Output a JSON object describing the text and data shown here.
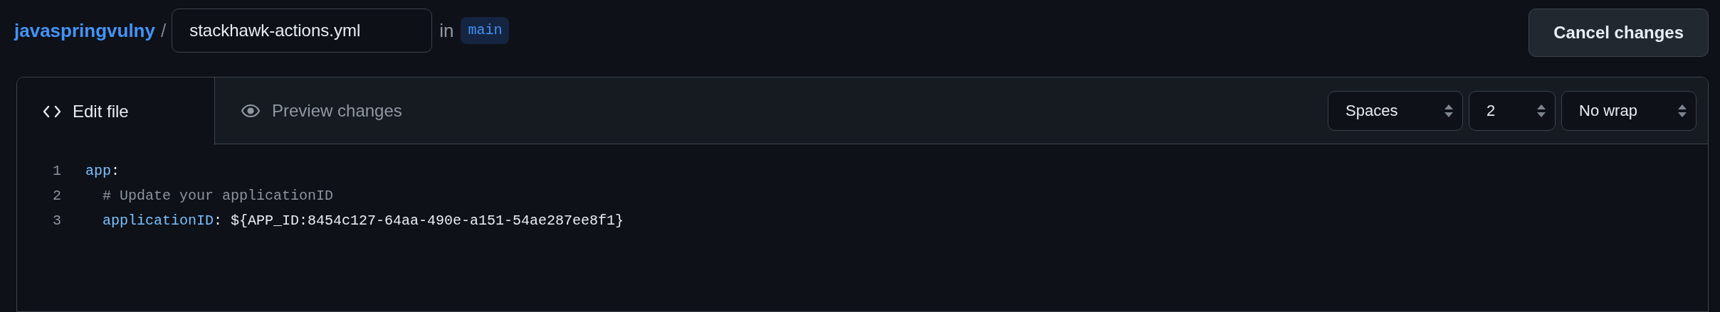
{
  "breadcrumb": {
    "repo": "javaspringvulny",
    "separator": "/",
    "file_name": "stackhawk-actions.yml",
    "in_label": "in",
    "branch": "main"
  },
  "cancel_button": "Cancel changes",
  "tabs": [
    {
      "label": "Edit file",
      "selected": true
    },
    {
      "label": "Preview changes",
      "selected": false
    }
  ],
  "selects": [
    {
      "value": "Spaces",
      "kind": "wide"
    },
    {
      "value": "2",
      "kind": "narrow"
    },
    {
      "value": "No wrap",
      "kind": "wide"
    }
  ],
  "code_lines": [
    {
      "number": "1",
      "tokens": [
        {
          "text": "app",
          "kind": "key"
        },
        {
          "text": ":",
          "kind": "plain"
        }
      ]
    },
    {
      "number": "2",
      "tokens": [
        {
          "text": "  # Update your applicationID",
          "kind": "comment"
        }
      ]
    },
    {
      "number": "3",
      "tokens": [
        {
          "text": "  applicationID",
          "kind": "key"
        },
        {
          "text": ": ${APP_ID:8454c127-64aa-490e-a151-54ae287ee8f1}",
          "kind": "plain"
        }
      ]
    }
  ]
}
